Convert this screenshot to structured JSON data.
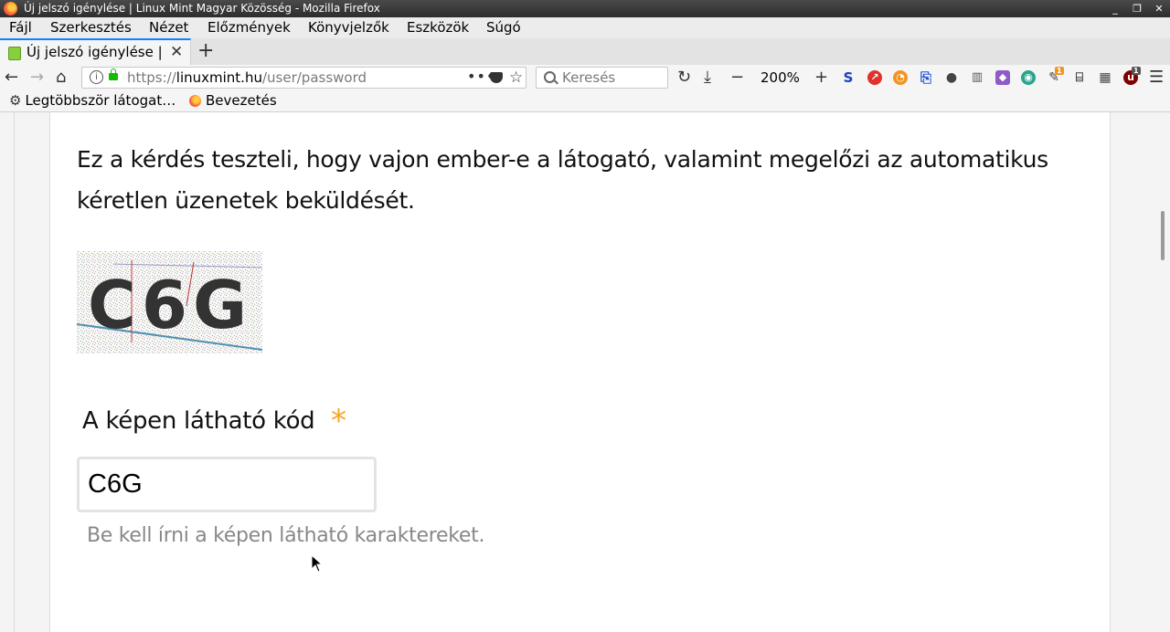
{
  "window": {
    "title": "Új jelszó igénylése | Linux Mint Magyar Közösség - Mozilla Firefox",
    "controls": [
      "_",
      "❐",
      "✕"
    ]
  },
  "menu": [
    "Fájl",
    "Szerkesztés",
    "Nézet",
    "Előzmények",
    "Könyvjelzők",
    "Eszközök",
    "Súgó"
  ],
  "tab": {
    "label": "Új jelszó igénylése | Linux",
    "close": "✕",
    "new": "+"
  },
  "nav": {
    "url_prefix": "https://",
    "url_host": "linuxmint.hu",
    "url_path": "/user/password",
    "page_actions": "•••",
    "search_placeholder": "Keresés",
    "zoom_minus": "−",
    "zoom": "200%",
    "zoom_plus": "+",
    "ext_badge_1": "1",
    "ext_badge_2": "1"
  },
  "bookmarks": [
    {
      "label": "Legtöbbször látogat…",
      "icon": "gear-icon"
    },
    {
      "label": "Bevezetés",
      "icon": "firefox-icon"
    }
  ],
  "content": {
    "description": "Ez a kérdés teszteli, hogy vajon ember-e a látogató, valamint megelőzi az automatikus kéretlen üzenetek beküldését.",
    "captcha_text": "C6G",
    "field_label": "A képen látható kód",
    "required_mark": "*",
    "input_value": "C6G",
    "help": "Be kell írni a képen látható karaktereket."
  },
  "colors": {
    "accent_tab": "#0a84ff",
    "required": "#f5a623",
    "help_text": "#888888"
  }
}
